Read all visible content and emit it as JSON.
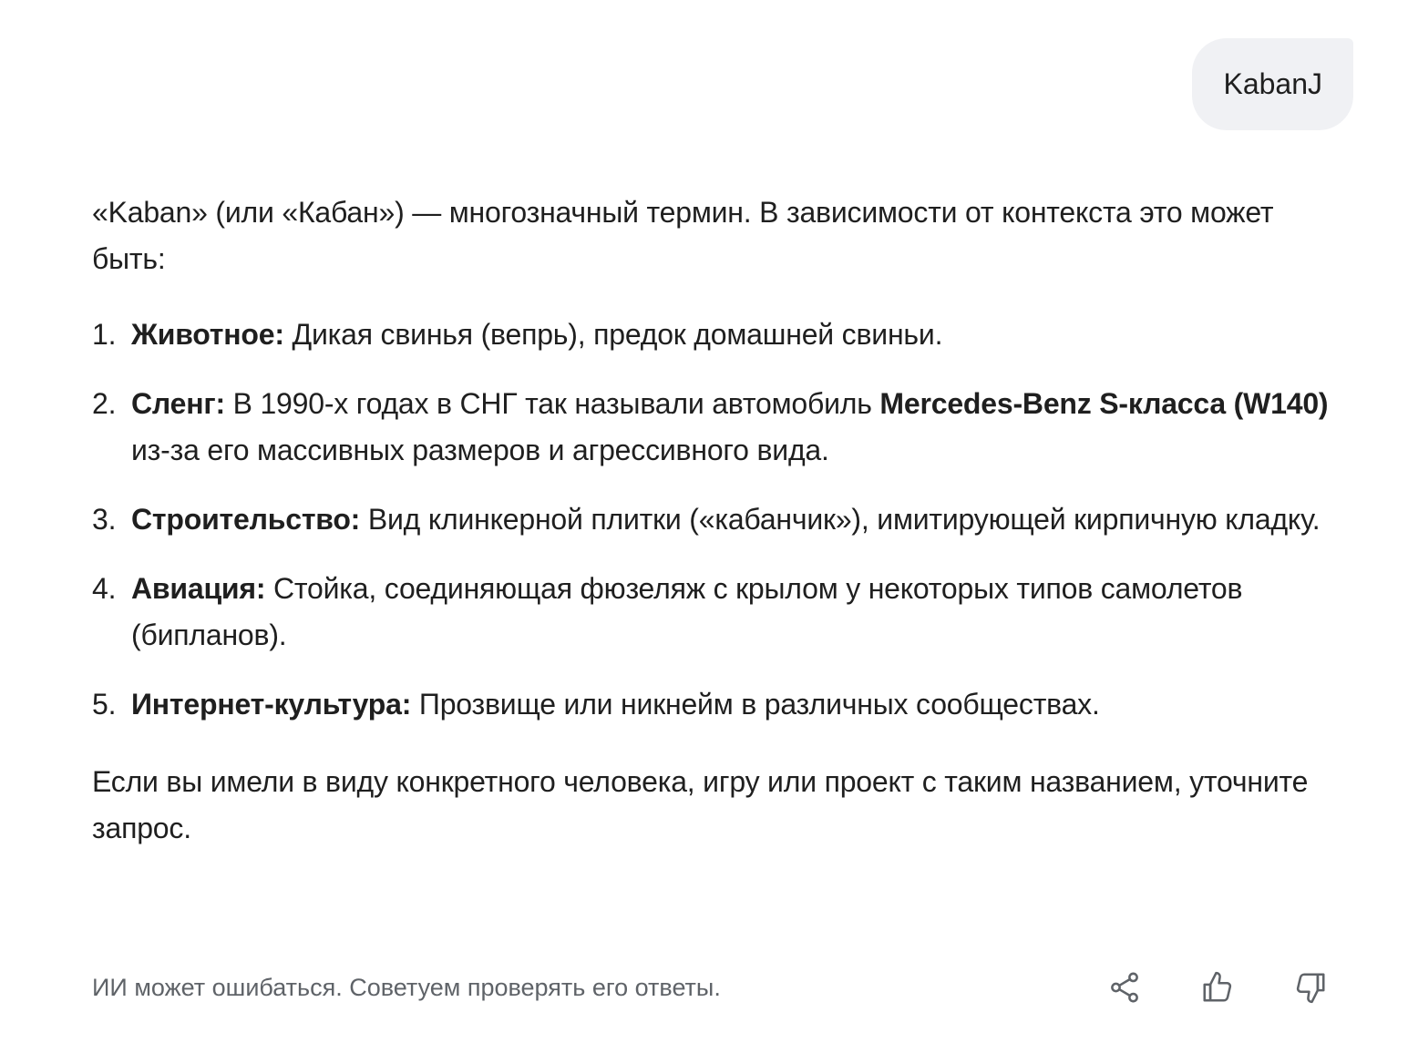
{
  "user_message": "KabanJ",
  "answer": {
    "intro": "«Kaban» (или «Кабан») — многозначный термин. В зависимости от контекста это может быть:",
    "items": [
      {
        "num": "1.",
        "term": "Животное:",
        "text": " Дикая свинья (вепрь), предок домашней свиньи."
      },
      {
        "num": "2.",
        "term": "Сленг:",
        "text_before": " В 1990-х годах в СНГ так называли автомобиль ",
        "bold_mid": "Mercedes-Benz S-класса (W140)",
        "text_after": " из-за его массивных размеров и агрессивного вида."
      },
      {
        "num": "3.",
        "term": "Строительство:",
        "text": " Вид клинкерной плитки («кабанчик»), имитирующей кирпичную кладку."
      },
      {
        "num": "4.",
        "term": "Авиация:",
        "text": " Стойка, соединяющая фюзеляж с крылом у некоторых типов самолетов (бипланов)."
      },
      {
        "num": "5.",
        "term": "Интернет-культура:",
        "text": " Прозвище или никнейм в различных сообществах."
      }
    ],
    "outro": "Если вы имели в виду конкретного человека, игру или проект с таким названием, уточните запрос."
  },
  "footer": {
    "disclaimer": "ИИ может ошибаться. Советуем проверять его ответы.",
    "icons": [
      "share-icon",
      "thumbs-up-icon",
      "thumbs-down-icon"
    ]
  },
  "colors": {
    "bubble_bg": "#f0f1f4",
    "text": "#1f1f1f",
    "muted_text": "#5f6368"
  }
}
